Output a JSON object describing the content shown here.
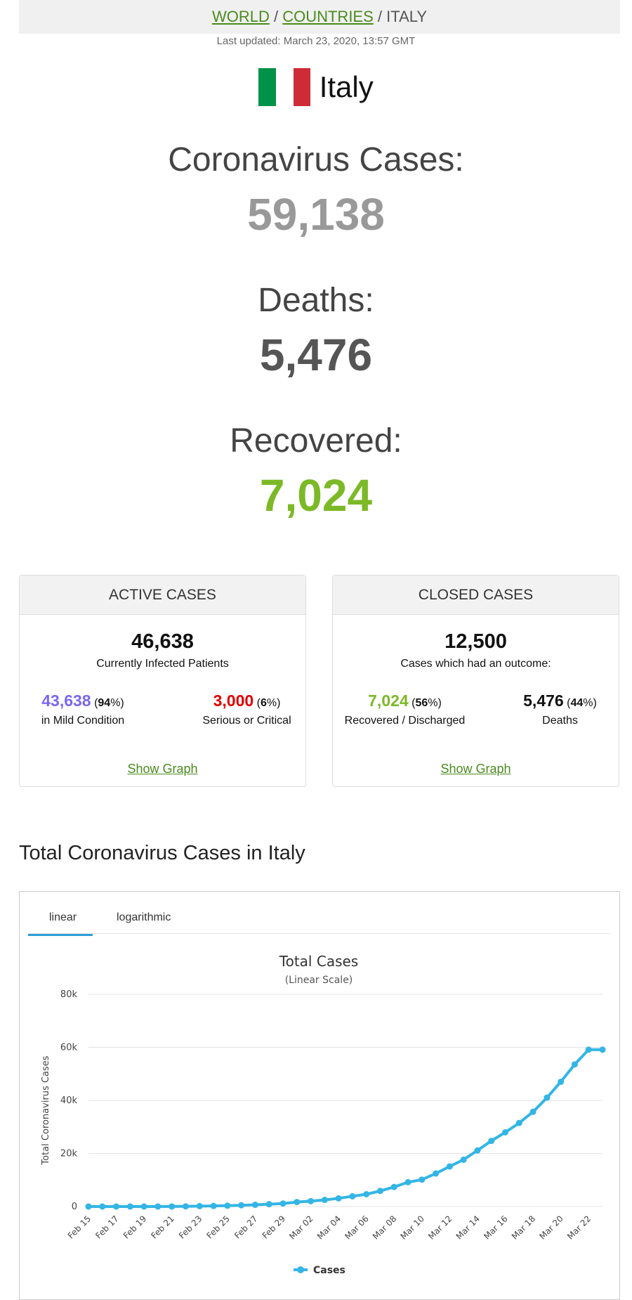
{
  "breadcrumb": {
    "world": "WORLD",
    "countries": "COUNTRIES",
    "current": "ITALY",
    "sep": "/"
  },
  "last_updated": "Last updated: March 23, 2020, 13:57 GMT",
  "country": {
    "name": "Italy",
    "flag_colors": [
      "#009246",
      "#ffffff",
      "#ce2b37"
    ]
  },
  "stats": {
    "cases_label": "Coronavirus Cases:",
    "cases_value": "59,138",
    "deaths_label": "Deaths:",
    "deaths_value": "5,476",
    "recovered_label": "Recovered:",
    "recovered_value": "7,024"
  },
  "colors": {
    "cases": "#999999",
    "deaths": "#555555",
    "recovered": "#7cb926",
    "mild": "#7b68ee",
    "critical": "#e00000",
    "link": "#4b8b1e",
    "line": "#33b5e5"
  },
  "active": {
    "header": "ACTIVE CASES",
    "total": "46,638",
    "sub": "Currently Infected Patients",
    "mild_value": "43,638",
    "mild_pct": "94",
    "mild_label": "in Mild Condition",
    "critical_value": "3,000",
    "critical_pct": "6",
    "critical_label": "Serious or Critical",
    "show_graph": "Show Graph"
  },
  "closed": {
    "header": "CLOSED CASES",
    "total": "12,500",
    "sub": "Cases which had an outcome:",
    "recovered_value": "7,024",
    "recovered_pct": "56",
    "recovered_label": "Recovered / Discharged",
    "deaths_value": "5,476",
    "deaths_pct": "44",
    "deaths_label": "Deaths",
    "show_graph": "Show Graph"
  },
  "section_title": "Total Coronavirus Cases in Italy",
  "tabs": {
    "linear": "linear",
    "log": "logarithmic"
  },
  "chart_data": {
    "type": "line",
    "title": "Total Cases",
    "subtitle": "(Linear Scale)",
    "ylabel": "Total Coronavirus Cases",
    "xlabel": "",
    "ylim": [
      0,
      80000
    ],
    "yticks": [
      "0",
      "20k",
      "40k",
      "60k",
      "80k"
    ],
    "grid": true,
    "legend": "bottom",
    "x": [
      "Feb 15",
      "Feb 16",
      "Feb 17",
      "Feb 18",
      "Feb 19",
      "Feb 20",
      "Feb 21",
      "Feb 22",
      "Feb 23",
      "Feb 24",
      "Feb 25",
      "Feb 26",
      "Feb 27",
      "Feb 28",
      "Feb 29",
      "Mar 01",
      "Mar 02",
      "Mar 03",
      "Mar 04",
      "Mar 05",
      "Mar 06",
      "Mar 07",
      "Mar 08",
      "Mar 09",
      "Mar 10",
      "Mar 11",
      "Mar 12",
      "Mar 13",
      "Mar 14",
      "Mar 15",
      "Mar 16",
      "Mar 17",
      "Mar 18",
      "Mar 19",
      "Mar 20",
      "Mar 21",
      "Mar 22",
      "Mar 23"
    ],
    "xtick_labels": [
      "Feb 15",
      "Feb 17",
      "Feb 19",
      "Feb 21",
      "Feb 23",
      "Feb 25",
      "Feb 27",
      "Feb 29",
      "Mar 02",
      "Mar 04",
      "Mar 06",
      "Mar 08",
      "Mar 10",
      "Mar 12",
      "Mar 14",
      "Mar 16",
      "Mar 18",
      "Mar 20",
      "Mar 22"
    ],
    "series": [
      {
        "name": "Cases",
        "values": [
          3,
          3,
          3,
          3,
          3,
          3,
          20,
          79,
          157,
          229,
          323,
          470,
          655,
          889,
          1128,
          1694,
          2036,
          2502,
          3089,
          3858,
          4636,
          5883,
          7375,
          9172,
          10149,
          12462,
          15113,
          17660,
          21157,
          24747,
          27980,
          31506,
          35713,
          41035,
          47021,
          53578,
          59138,
          59138
        ]
      }
    ]
  }
}
